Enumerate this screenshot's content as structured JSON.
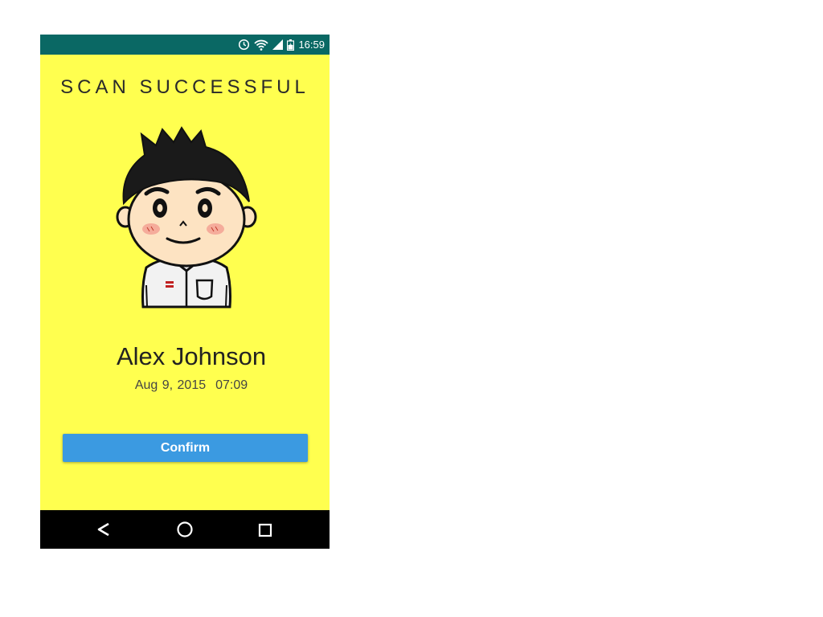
{
  "status_bar": {
    "time": "16:59",
    "icons": [
      "alarm-icon",
      "wifi-icon",
      "signal-icon",
      "battery-charging-icon"
    ],
    "background": "#0a6864"
  },
  "screen": {
    "title": "SCAN SUCCESSFUL",
    "background": "#ffff4f",
    "avatar": "cartoon-boy-avatar",
    "person_name": "Alex Johnson",
    "date": "Aug 9, 2015",
    "time": "07:09",
    "confirm_label": "Confirm",
    "confirm_color": "#3b9ae1"
  },
  "nav_bar": {
    "icons": [
      "back-icon",
      "home-icon",
      "recents-icon"
    ]
  }
}
